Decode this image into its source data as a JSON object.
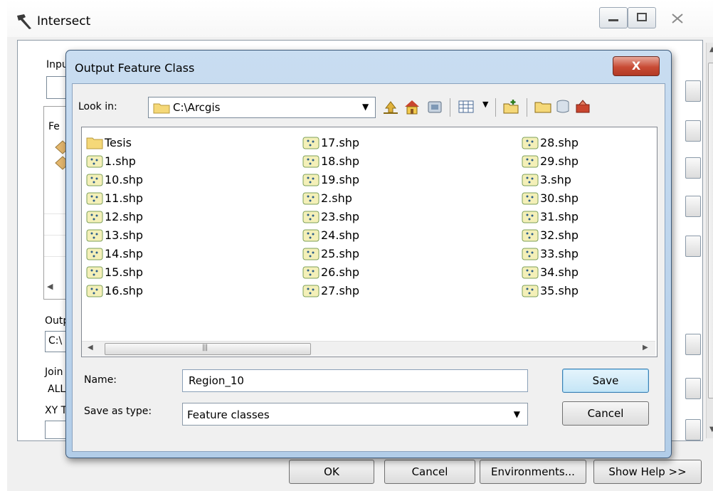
{
  "background_window": {
    "title": "Intersect",
    "labels": {
      "input": "Inpu",
      "features_header": "Fe",
      "output": "Outp",
      "output_value": "C:\\",
      "join": "Join",
      "join_value": "ALL",
      "xy_tolerance": "XY T"
    },
    "buttons": {
      "ok": "OK",
      "cancel": "Cancel",
      "environments": "Environments...",
      "show_help": "Show Help >>"
    }
  },
  "dialog": {
    "title": "Output Feature Class",
    "close_glyph": "X",
    "look_in_label": "Look in:",
    "look_in_value": "C:\\Arcgis",
    "files": {
      "column1": [
        "Tesis",
        "1.shp",
        "10.shp",
        "11.shp",
        "12.shp",
        "13.shp",
        "14.shp",
        "15.shp",
        "16.shp"
      ],
      "column2": [
        "17.shp",
        "18.shp",
        "19.shp",
        "2.shp",
        "23.shp",
        "24.shp",
        "25.shp",
        "26.shp",
        "27.shp"
      ],
      "column3": [
        "28.shp",
        "29.shp",
        "3.shp",
        "30.shp",
        "31.shp",
        "32.shp",
        "33.shp",
        "34.shp",
        "35.shp"
      ]
    },
    "name_label": "Name:",
    "name_value": "Region_10",
    "save_as_type_label": "Save as type:",
    "save_as_type_value": "Feature classes",
    "save_button": "Save",
    "cancel_button": "Cancel"
  },
  "icons": {
    "folder_color": "#f5d878",
    "shapefile_color": "#f4f0b8",
    "shapefile_border": "#7da05a",
    "title_bar_blue": "#c4daf0",
    "close_red": "#c84b35"
  }
}
